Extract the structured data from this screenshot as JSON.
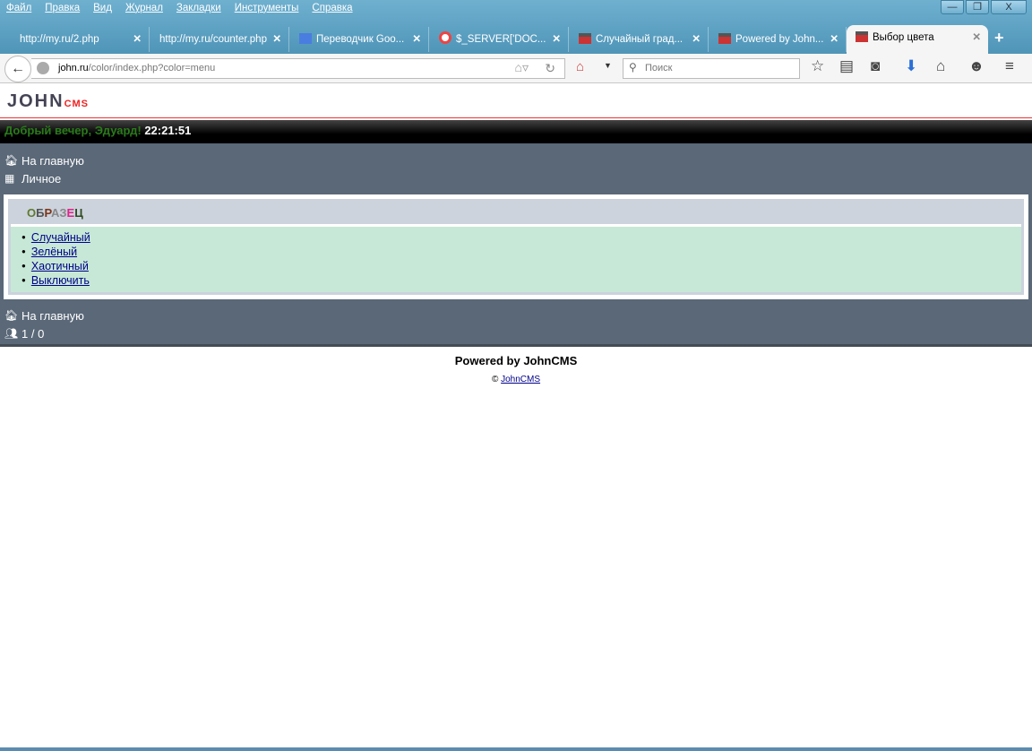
{
  "menu": [
    "Файл",
    "Правка",
    "Вид",
    "Журнал",
    "Закладки",
    "Инструменты",
    "Справка"
  ],
  "tabs": [
    {
      "label": "http://my.ru/2.php"
    },
    {
      "label": "http://my.ru/counter.php"
    },
    {
      "label": "Переводчик Goo..."
    },
    {
      "label": "$_SERVER['DOC..."
    },
    {
      "label": "Случайный град..."
    },
    {
      "label": "Powered by John..."
    },
    {
      "label": "Выбор цвета"
    }
  ],
  "url": {
    "host": "john.ru",
    "path": "/color/index.php?color=menu"
  },
  "search_placeholder": "Поиск",
  "logo": {
    "john": "JOHN",
    "cms": "CMS"
  },
  "greeting": {
    "text": "Добрый вечер, Эдуард!",
    "time": "22:21:51"
  },
  "nav_top": [
    {
      "label": "На главную"
    },
    {
      "label": "Личное"
    }
  ],
  "sample": {
    "letters": [
      {
        "ch": "О",
        "color": "#5e7a2e"
      },
      {
        "ch": "Б",
        "color": "#555555"
      },
      {
        "ch": "Р",
        "color": "#7a3518"
      },
      {
        "ch": "А",
        "color": "#888888"
      },
      {
        "ch": "З",
        "color": "#888888"
      },
      {
        "ch": "Е",
        "color": "#e0218a"
      },
      {
        "ch": "Ц",
        "color": "#2f4a1f"
      }
    ]
  },
  "options": [
    "Случайный",
    "Зелёный",
    "Хаотичный",
    "Выключить"
  ],
  "nav_bottom": {
    "home": "На главную",
    "online": "1 / 0"
  },
  "footer": {
    "powered": "Powered by JohnCMS",
    "copy": "©",
    "link": "JohnCMS"
  }
}
